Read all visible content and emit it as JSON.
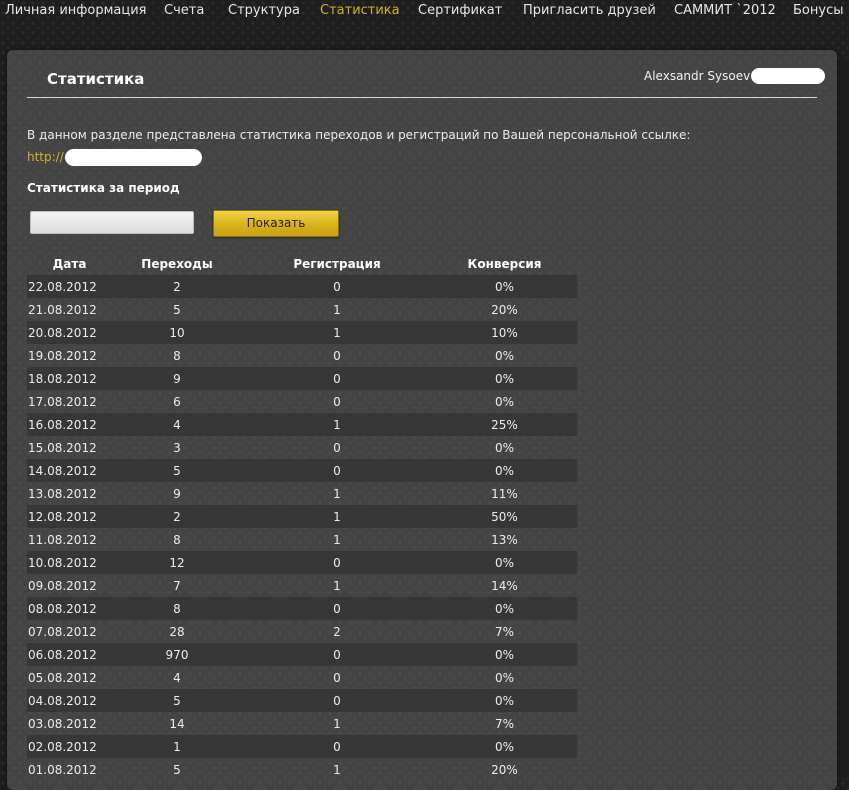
{
  "nav": {
    "items": [
      {
        "label": "Личная информация",
        "active": false
      },
      {
        "label": "Счета",
        "active": false
      },
      {
        "label": "Структура",
        "active": false
      },
      {
        "label": "Статистика",
        "active": true
      },
      {
        "label": "Сертификат",
        "active": false
      },
      {
        "label": "Пригласить друзей",
        "active": false
      },
      {
        "label": "САММИТ `2012",
        "active": false
      },
      {
        "label": "Бонусы",
        "active": false
      }
    ],
    "active_color": "#d4b02a"
  },
  "page": {
    "title": "Статистика",
    "user_name": "Alexsandr Sysoev",
    "intro": "В данном разделе представлена статистика переходов и регистраций по Вашей персональной ссылке:",
    "ref_link_prefix": "http://",
    "period_label": "Статистика за период",
    "date_input_value": "",
    "show_button_label": "Показать"
  },
  "table": {
    "headers": [
      "Дата",
      "Переходы",
      "Регистрация",
      "Конверсия"
    ],
    "rows": [
      {
        "date": "22.08.2012",
        "visits": "2",
        "registrations": "0",
        "conversion": "0%"
      },
      {
        "date": "21.08.2012",
        "visits": "5",
        "registrations": "1",
        "conversion": "20%"
      },
      {
        "date": "20.08.2012",
        "visits": "10",
        "registrations": "1",
        "conversion": "10%"
      },
      {
        "date": "19.08.2012",
        "visits": "8",
        "registrations": "0",
        "conversion": "0%"
      },
      {
        "date": "18.08.2012",
        "visits": "9",
        "registrations": "0",
        "conversion": "0%"
      },
      {
        "date": "17.08.2012",
        "visits": "6",
        "registrations": "0",
        "conversion": "0%"
      },
      {
        "date": "16.08.2012",
        "visits": "4",
        "registrations": "1",
        "conversion": "25%"
      },
      {
        "date": "15.08.2012",
        "visits": "3",
        "registrations": "0",
        "conversion": "0%"
      },
      {
        "date": "14.08.2012",
        "visits": "5",
        "registrations": "0",
        "conversion": "0%"
      },
      {
        "date": "13.08.2012",
        "visits": "9",
        "registrations": "1",
        "conversion": "11%"
      },
      {
        "date": "12.08.2012",
        "visits": "2",
        "registrations": "1",
        "conversion": "50%"
      },
      {
        "date": "11.08.2012",
        "visits": "8",
        "registrations": "1",
        "conversion": "13%"
      },
      {
        "date": "10.08.2012",
        "visits": "12",
        "registrations": "0",
        "conversion": "0%"
      },
      {
        "date": "09.08.2012",
        "visits": "7",
        "registrations": "1",
        "conversion": "14%"
      },
      {
        "date": "08.08.2012",
        "visits": "8",
        "registrations": "0",
        "conversion": "0%"
      },
      {
        "date": "07.08.2012",
        "visits": "28",
        "registrations": "2",
        "conversion": "7%"
      },
      {
        "date": "06.08.2012",
        "visits": "970",
        "registrations": "0",
        "conversion": "0%"
      },
      {
        "date": "05.08.2012",
        "visits": "4",
        "registrations": "0",
        "conversion": "0%"
      },
      {
        "date": "04.08.2012",
        "visits": "5",
        "registrations": "0",
        "conversion": "0%"
      },
      {
        "date": "03.08.2012",
        "visits": "14",
        "registrations": "1",
        "conversion": "7%"
      },
      {
        "date": "02.08.2012",
        "visits": "1",
        "registrations": "0",
        "conversion": "0%"
      },
      {
        "date": "01.08.2012",
        "visits": "5",
        "registrations": "1",
        "conversion": "20%"
      }
    ]
  }
}
